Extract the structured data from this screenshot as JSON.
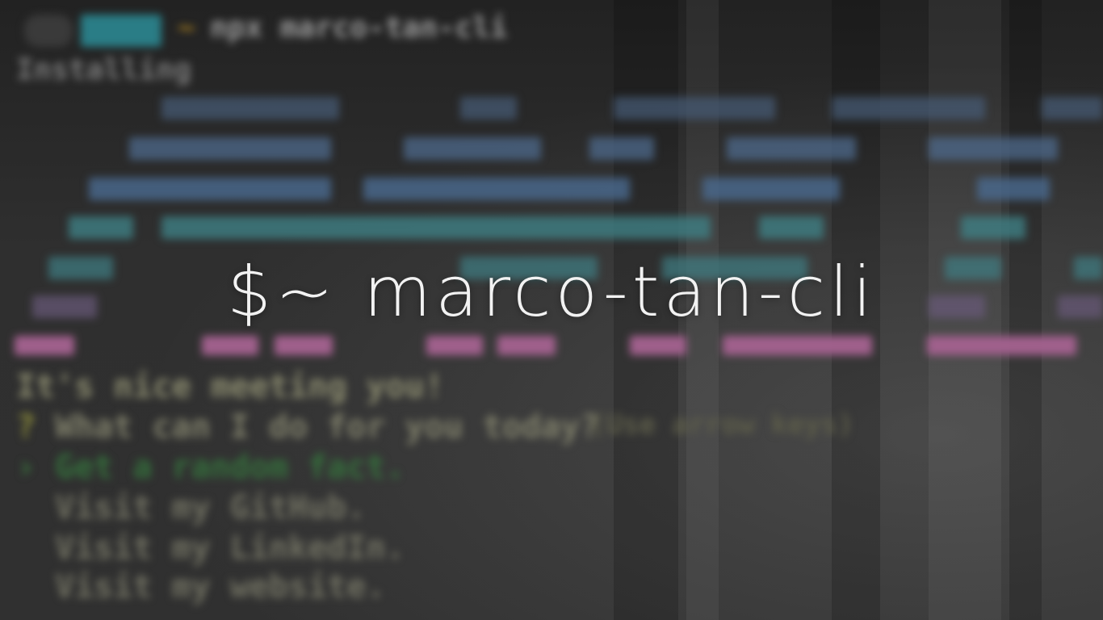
{
  "title": "$~ marco-tan-cli",
  "terminal": {
    "prompt_path": "~",
    "prompt_command": "npx marco-tan-cli",
    "status_line": "Installing",
    "greeting": "It's nice meeting you!",
    "question": "What can I do for you today?",
    "question_hint": "(Use arrow keys)",
    "options": [
      "Get a random fact.",
      "Visit my GitHub.",
      "Visit my LinkedIn.",
      "Visit my website."
    ]
  },
  "colors": {
    "title": "#f2f2f2",
    "background": "#2c2c2c",
    "ascii_blue": "#5a7aa0",
    "ascii_teal": "#4f8f8f",
    "ascii_pink": "#b0689a",
    "prompt_yellow": "#c9b44e",
    "selected_green": "#3f9a4a"
  },
  "icons": {
    "terminal_badge": "apple-icon"
  }
}
